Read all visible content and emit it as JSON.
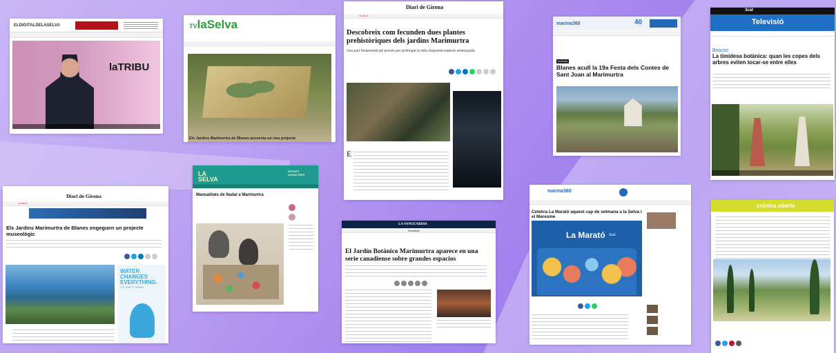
{
  "colors": {
    "accent_red": "#c8102e",
    "tv_green": "#2a9d3b",
    "selva_teal": "#1f9a8f",
    "ondacero": "#2468b8",
    "tv3_blue": "#1f6fc5",
    "cronica_yellow": "#d6dc2c"
  },
  "cards": {
    "c1": {
      "brand": "ELDIGITALDELASELVA",
      "show": "laTRIBU"
    },
    "c2": {
      "brand_tv": "TV",
      "brand_name": "laSelva",
      "caption": "Els Jardins Marimurtra de Blanes presenta un nou projecte"
    },
    "c3": {
      "brand": "Diari de Girona",
      "nav": "LA SELVA",
      "headline": "Descobreix com fecunden dues plantes prehistòriques dels jardins Marimurtra",
      "subhead": "Una part fonamental pel procés per prolongar la vida d'aquesta espècie amenaçada",
      "body_lead": "E"
    },
    "c4": {
      "brand": "marina360",
      "badge": "40",
      "tag": "NOTÍCIES",
      "headline": "Blanes acull la 19a Festa dels Contes de Sant Joan al Marimurtra"
    },
    "c5": {
      "brand": "Televisió",
      "section": "Boscos",
      "headline": "La timidesa botànica: quan les copes dels arbres eviten tocar-se entre elles",
      "channel": "3cat"
    },
    "c6": {
      "brand": "Diari de Girona",
      "nav": "LA SELVA",
      "headline": "Els Jardins Marimurtra de Blanes engeguen un projecte museològic",
      "ad": "WATER CHANGES EVERYTHING.",
      "ad_small": "IT'S TIME TO SHARE"
    },
    "c7": {
      "brand": "LA SELVA",
      "badge": "ESPORT NOSALTRES",
      "headline": "Manualitats de Nadal a Marimurtra"
    },
    "c8": {
      "brand": "LA VANGUARDIA",
      "section": "Sociedad",
      "headline": "El Jardín Botánico Marimurtra aparece en una serie canadiense sobre grandes espacios"
    },
    "c9": {
      "brand": "marina360",
      "headline": "Celebra La Marató aquest cap de setmana a la Selva i el Maresme",
      "banner": "La Marató",
      "banner_small": "3cat"
    },
    "c10": {
      "brand": "crónica oberta"
    }
  }
}
